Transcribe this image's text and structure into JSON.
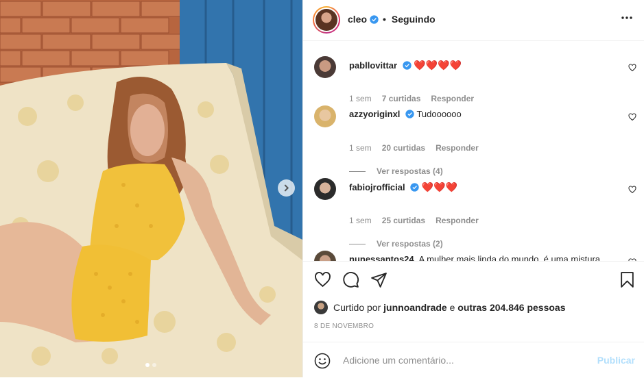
{
  "header": {
    "username": "cleo",
    "separator": "•",
    "follow_status": "Seguindo"
  },
  "comments": [
    {
      "username": "pabllovittar",
      "text": "❤️❤️❤️❤️",
      "time": "1 sem",
      "likes": "7 curtidas",
      "reply": "Responder",
      "replies": ""
    },
    {
      "username": "azzyoriginxl",
      "text": "Tudoooooo",
      "time": "1 sem",
      "likes": "20 curtidas",
      "reply": "Responder",
      "replies": "Ver respostas (4)"
    },
    {
      "username": "fabiojrofficial",
      "text": "❤️❤️❤️",
      "time": "1 sem",
      "likes": "25 curtidas",
      "reply": "Responder",
      "replies": "Ver respostas (2)"
    },
    {
      "username": "nunessantos24",
      "text": "A mulher mais linda do mundo, é uma mistura",
      "time": "",
      "likes": "",
      "reply": "",
      "replies": ""
    }
  ],
  "likes": {
    "prefix": "Curtido por",
    "user": "junnoandrade",
    "conj": "e",
    "others": "outras 204.846 pessoas"
  },
  "date": "8 DE NOVEMBRO",
  "add_comment": {
    "placeholder": "Adicione um comentário...",
    "publish": "Publicar"
  },
  "carousel": {
    "count": 2,
    "active": 0
  },
  "colors": {
    "verified": "#3897f0",
    "heart": "#ed4956",
    "publish_disabled": "#b2dffc",
    "muted": "#8e8e8e"
  }
}
